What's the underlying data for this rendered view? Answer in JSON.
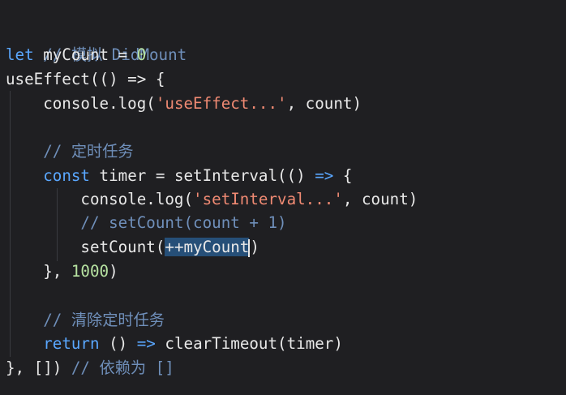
{
  "code": {
    "line1": {
      "comment": "// 模拟 DidMount"
    },
    "line2": {
      "kw": "let",
      "rest": " myCount = ",
      "num": "0"
    },
    "line3": {
      "text": "useEffect(() => {"
    },
    "line4": {
      "pre": "    console.log(",
      "str": "'useEffect...'",
      "post": ", count)"
    },
    "line6": {
      "indent": "    ",
      "comment": "// 定时任务"
    },
    "line7": {
      "indent": "    ",
      "kw": "const",
      "rest": " timer = setInterval(() ",
      "arrow": "=>",
      "post": " {"
    },
    "line8": {
      "pre": "        console.log(",
      "str": "'setInterval...'",
      "post": ", count)"
    },
    "line9": {
      "indent": "        ",
      "comment": "// setCount(count + 1)"
    },
    "line10": {
      "pre": "        setCount(",
      "selected": "++myCount",
      "post": ")"
    },
    "line11": {
      "pre": "    }, ",
      "num": "1000",
      "post": ")"
    },
    "line13": {
      "indent": "    ",
      "comment": "// 清除定时任务"
    },
    "line14": {
      "indent": "    ",
      "kw": "return",
      "rest": " () ",
      "arrow": "=>",
      "post": " clearTimeout(timer)"
    },
    "line15": {
      "pre": "}, []) ",
      "comment": "// 依赖为 []"
    }
  },
  "colors": {
    "background": "#1f1f22",
    "keyword": "#5aa7ff",
    "string": "#f08a73",
    "comment": "#6f8fba",
    "number": "#b7e3a2",
    "selection": "#264f78"
  }
}
